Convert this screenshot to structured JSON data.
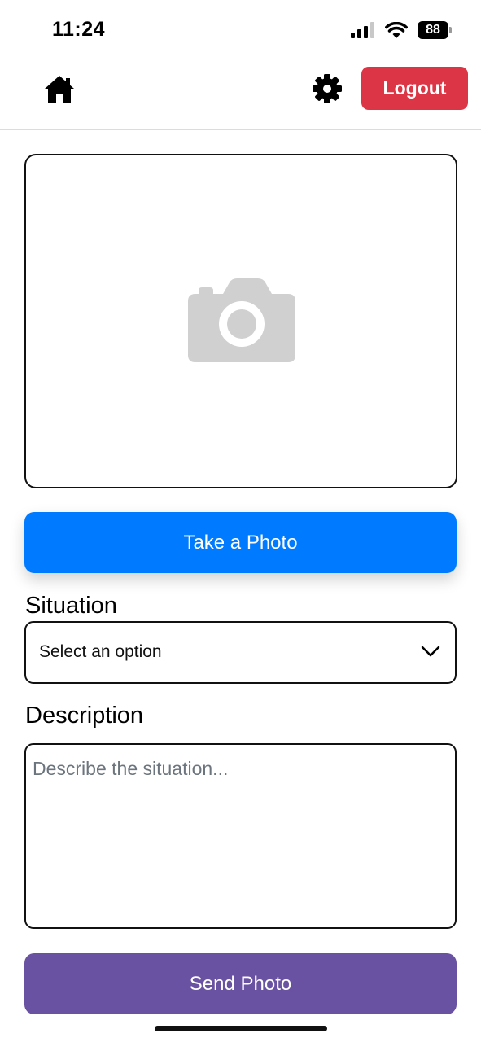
{
  "status_bar": {
    "time": "11:24",
    "battery_level": "88",
    "icons": [
      "cellular-signal-icon",
      "wifi-icon",
      "battery-icon"
    ]
  },
  "header": {
    "home_icon": "home-icon",
    "settings_icon": "gear-icon",
    "logout_label": "Logout"
  },
  "photo_preview": {
    "icon": "camera-icon"
  },
  "take_photo": {
    "label": "Take a Photo"
  },
  "situation": {
    "label": "Situation",
    "selected_value": "Select an option"
  },
  "description": {
    "label": "Description",
    "placeholder": "Describe the situation..."
  },
  "send_photo": {
    "label": "Send Photo"
  },
  "colors": {
    "logout": "#dc3545",
    "take_photo": "#007bff",
    "send_photo": "#6a52a3",
    "placeholder_text": "#6c757d"
  }
}
